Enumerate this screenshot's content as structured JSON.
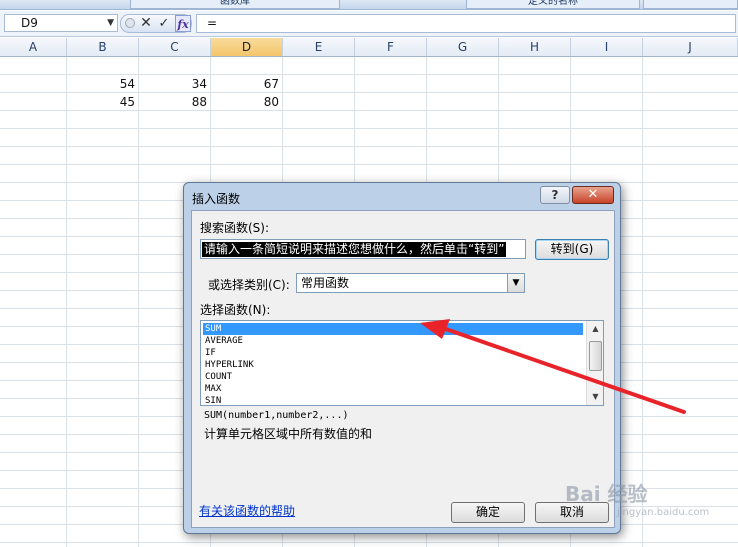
{
  "ribbon": {
    "tab_left": "函数库",
    "tab_right": "定义的名称"
  },
  "formula_bar": {
    "name_box": "D9",
    "cancel_glyph": "✕",
    "enter_glyph": "✓",
    "fx_label": "fx",
    "formula_value": "="
  },
  "columns": [
    "A",
    "B",
    "C",
    "D",
    "E",
    "F",
    "G",
    "H",
    "I",
    "J"
  ],
  "selected_column": "D",
  "cells": {
    "B3": "54",
    "C3": "34",
    "D3": "67",
    "B4": "45",
    "C4": "88",
    "D4": "80"
  },
  "dialog": {
    "title": "插入函数",
    "help_button": "?",
    "close_button": "✕",
    "search_label": "搜索函数(S):",
    "search_value": "请输入一条简短说明来描述您想做什么，然后单击“转到”",
    "goto_button": "转到(G)",
    "category_label": "或选择类别(C):",
    "category_value": "常用函数",
    "function_label": "选择函数(N):",
    "functions": [
      "SUM",
      "AVERAGE",
      "IF",
      "HYPERLINK",
      "COUNT",
      "MAX",
      "SIN"
    ],
    "selected_function": "SUM",
    "syntax": "SUM(number1,number2,...)",
    "description": "计算单元格区域中所有数值的和",
    "help_link": "有关该函数的帮助",
    "ok_button": "确定",
    "cancel_button": "取消"
  },
  "annotation": {
    "arrow_color": "#e8232a"
  },
  "watermark": {
    "text": "Bai 经验",
    "sub": "jingyan.baidu.com"
  }
}
